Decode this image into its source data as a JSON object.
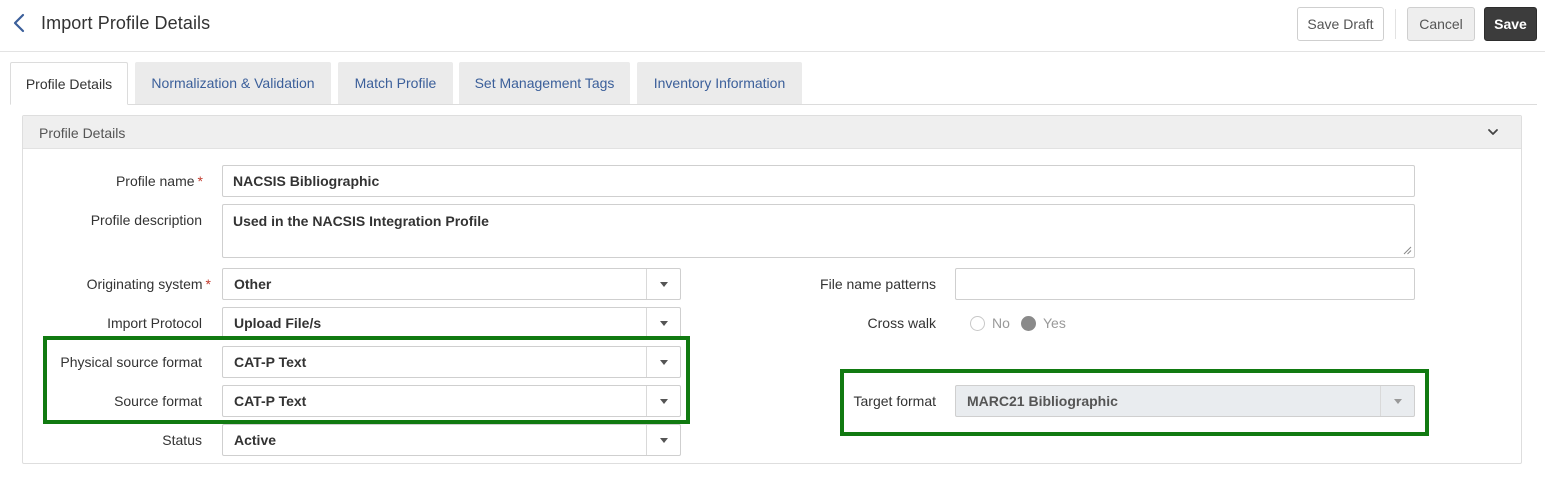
{
  "header": {
    "title": "Import Profile Details",
    "save_draft_label": "Save Draft",
    "cancel_label": "Cancel",
    "save_label": "Save"
  },
  "tabs": [
    {
      "label": "Profile Details",
      "active": true
    },
    {
      "label": "Normalization & Validation",
      "active": false
    },
    {
      "label": "Match Profile",
      "active": false
    },
    {
      "label": "Set Management Tags",
      "active": false
    },
    {
      "label": "Inventory Information",
      "active": false
    }
  ],
  "panel": {
    "title": "Profile Details"
  },
  "form": {
    "profile_name": {
      "label": "Profile name",
      "required": "*",
      "value": "NACSIS Bibliographic"
    },
    "profile_description": {
      "label": "Profile description",
      "value": "Used in the NACSIS Integration Profile"
    },
    "originating_system": {
      "label": "Originating system",
      "required": "*",
      "value": "Other"
    },
    "import_protocol": {
      "label": "Import Protocol",
      "value": "Upload File/s"
    },
    "physical_source_format": {
      "label": "Physical source format",
      "value": "CAT-P Text"
    },
    "source_format": {
      "label": "Source format",
      "value": "CAT-P Text"
    },
    "status": {
      "label": "Status",
      "value": "Active"
    },
    "file_name_patterns": {
      "label": "File name patterns",
      "value": ""
    },
    "cross_walk": {
      "label": "Cross walk",
      "options": [
        "No",
        "Yes"
      ],
      "selected": "Yes"
    },
    "target_format": {
      "label": "Target format",
      "value": "MARC21 Bibliographic",
      "disabled": true
    }
  },
  "colors": {
    "highlight": "#117a11",
    "link_tab": "#3b5f9a",
    "save_button": "#3c3c3c",
    "required": "#c0392b"
  },
  "icons": {
    "back": "chevron-left-icon",
    "collapse": "chevron-down-icon",
    "dropdown": "caret-down-icon"
  }
}
